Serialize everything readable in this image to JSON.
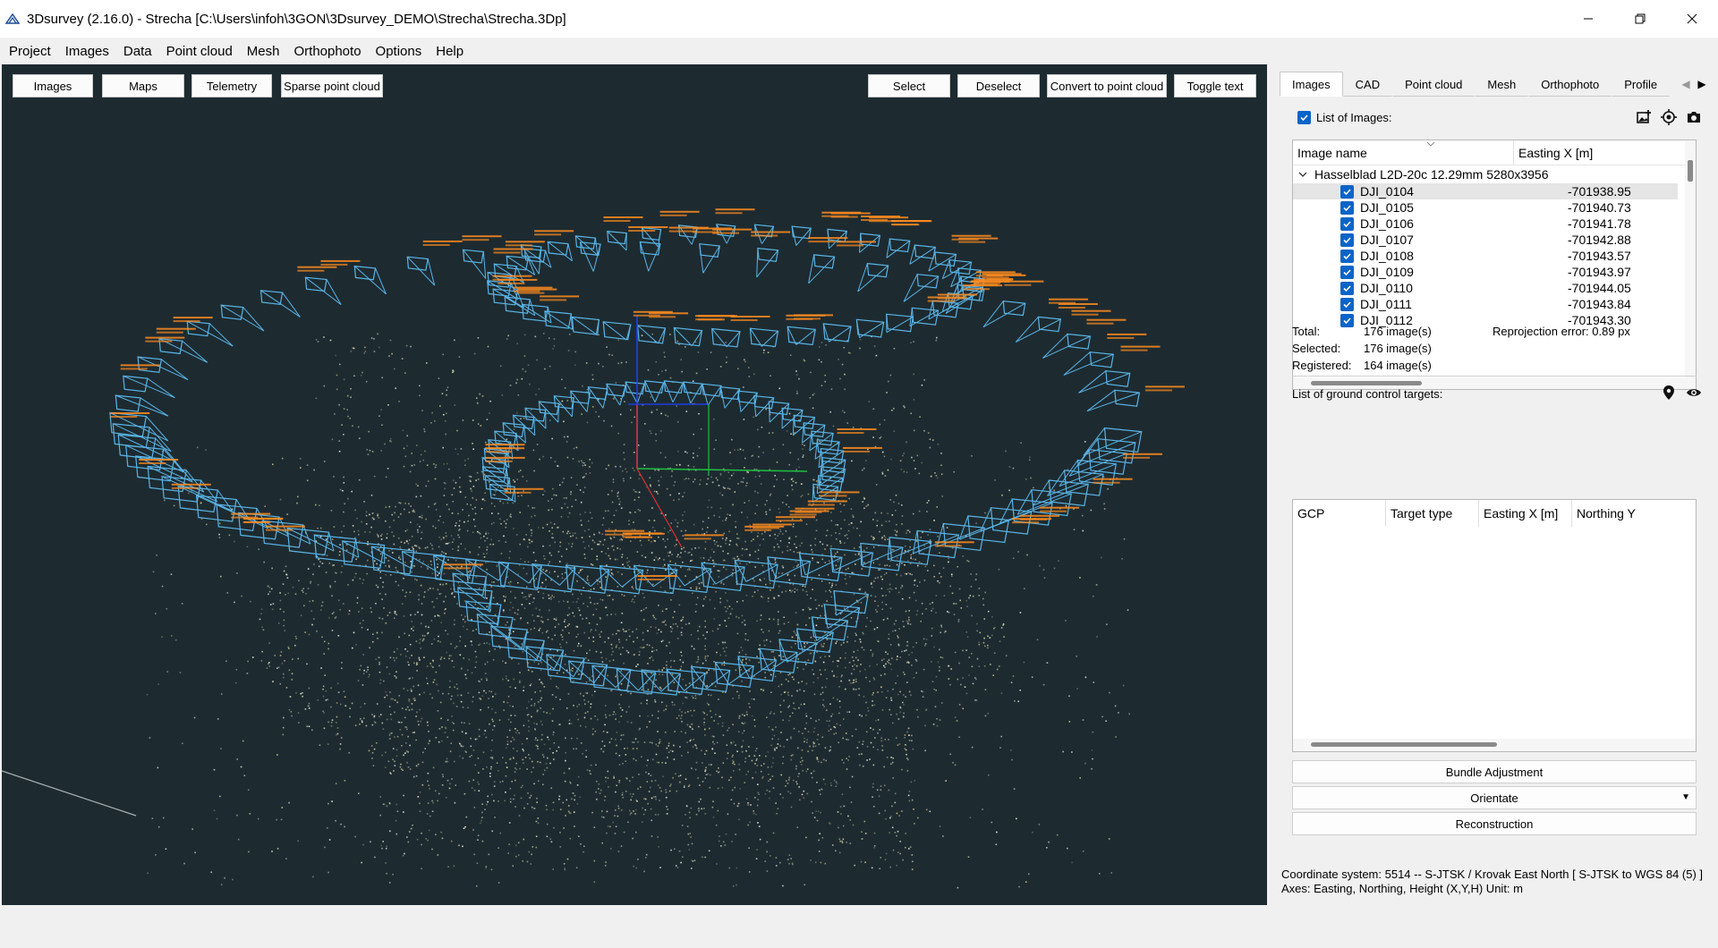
{
  "window": {
    "title": "3Dsurvey (2.16.0) - Strecha [C:\\Users\\infoh\\3GON\\3Dsurvey_DEMO\\Strecha\\Strecha.3Dp]"
  },
  "menu": [
    "Project",
    "Images",
    "Data",
    "Point cloud",
    "Mesh",
    "Orthophoto",
    "Options",
    "Help"
  ],
  "viewport_toolbar": {
    "left": [
      "Images",
      "Maps",
      "Telemetry",
      "Sparse point cloud"
    ],
    "right": [
      "Select",
      "Deselect",
      "Convert to point cloud",
      "Toggle text"
    ]
  },
  "tabs": [
    "Images",
    "CAD",
    "Point cloud",
    "Mesh",
    "Orthophoto",
    "Profile"
  ],
  "images_panel": {
    "list_label": "List of Images:",
    "columns": [
      "Image name",
      "Easting X [m]"
    ],
    "group": "Hasselblad L2D-20c 12.29mm 5280x3956",
    "rows": [
      {
        "name": "DJI_0104",
        "easting": "-701938.95"
      },
      {
        "name": "DJI_0105",
        "easting": "-701940.73"
      },
      {
        "name": "DJI_0106",
        "easting": "-701941.78"
      },
      {
        "name": "DJI_0107",
        "easting": "-701942.88"
      },
      {
        "name": "DJI_0108",
        "easting": "-701943.57"
      },
      {
        "name": "DJI_0109",
        "easting": "-701943.97"
      },
      {
        "name": "DJI_0110",
        "easting": "-701944.05"
      },
      {
        "name": "DJI_0111",
        "easting": "-701943.84"
      },
      {
        "name": "DJI_0112",
        "easting": "-701943.30"
      }
    ],
    "total_label": "Total:",
    "total_value": "176 image(s)",
    "selected_label": "Selected:",
    "selected_value": "176 image(s)",
    "registered_label": "Registered:",
    "registered_value": "164 image(s)",
    "reprojection": "Reprojection error:  0.89 px"
  },
  "gcp_panel": {
    "label": "List of ground control targets:",
    "columns": [
      "GCP",
      "Target type",
      "Easting X [m]",
      "Northing Y"
    ]
  },
  "actions": {
    "bundle": "Bundle Adjustment",
    "orientate": "Orientate",
    "reconstruction": "Reconstruction"
  },
  "coordinate": {
    "line1": "Coordinate system: 5514 -- S-JTSK / Krovak East North [ S-JTSK to WGS 84 (5) ]",
    "line2": "Axes: Easting, Northing, Height (X,Y,H) Unit: m"
  },
  "colors": {
    "viewport_bg": "#1d2b31",
    "camera": "#5ab4e6",
    "label": "#ff8c1e",
    "checkbox": "#0a64c8"
  }
}
